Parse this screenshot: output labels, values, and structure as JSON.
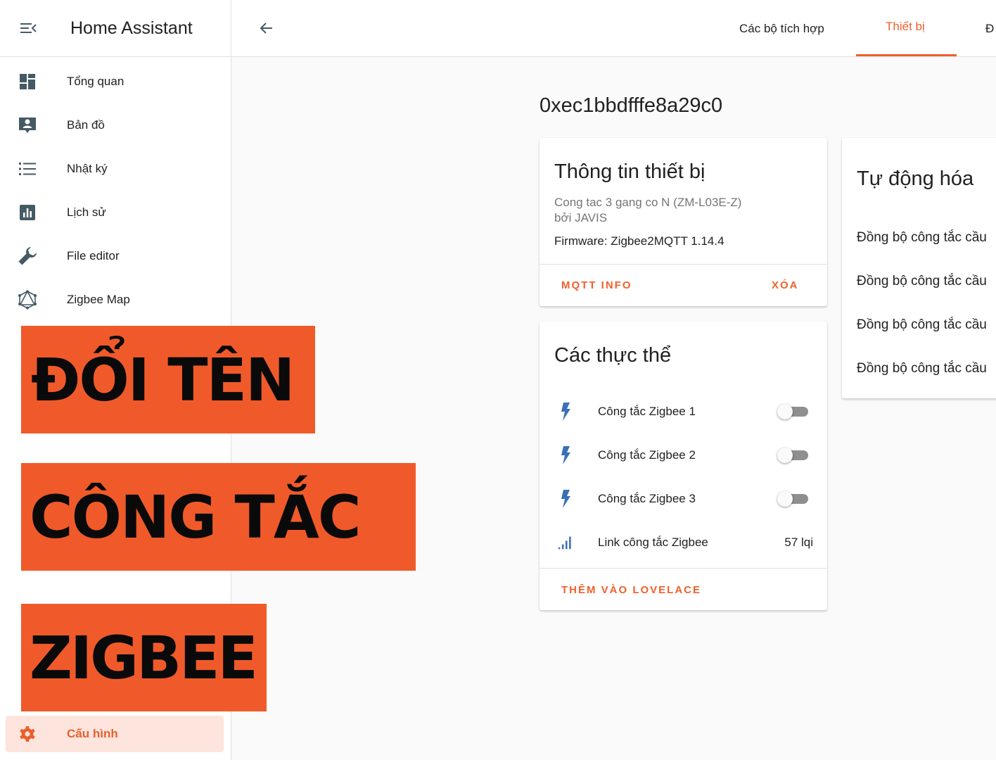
{
  "app": {
    "title": "Home Assistant"
  },
  "sidebar": {
    "items": [
      {
        "label": "Tổng quan",
        "icon": "dashboard-icon"
      },
      {
        "label": "Bản đồ",
        "icon": "map-icon"
      },
      {
        "label": "Nhật ký",
        "icon": "logbook-icon"
      },
      {
        "label": "Lịch sử",
        "icon": "history-chart-icon"
      },
      {
        "label": "File editor",
        "icon": "wrench-icon"
      },
      {
        "label": "Zigbee Map",
        "icon": "zigbee-graph-icon"
      }
    ],
    "active_item": {
      "label": "Cấu hình",
      "icon": "gear-icon"
    }
  },
  "topbar": {
    "tabs": [
      {
        "label": "Các bộ tích hợp"
      },
      {
        "label": "Thiết bị"
      },
      {
        "label": "Đ"
      }
    ],
    "active_tab": "Thiết bị"
  },
  "device": {
    "title": "0xec1bbdfffe8a29c0",
    "info_card": {
      "title": "Thông tin thiết bị",
      "model": "Cong tac 3 gang co N (ZM-L03E-Z)",
      "manufacturer": "bởi JAVIS",
      "firmware": "Firmware: Zigbee2MQTT 1.14.4",
      "actions": {
        "mqtt": "MQTT INFO",
        "delete": "XÓA"
      }
    },
    "entities_card": {
      "title": "Các thực thể",
      "entities": [
        {
          "label": "Công tắc Zigbee 1",
          "icon": "lightning-icon",
          "state": "off"
        },
        {
          "label": "Công tắc Zigbee 2",
          "icon": "lightning-icon",
          "state": "off"
        },
        {
          "label": "Công tắc Zigbee 3",
          "icon": "lightning-icon",
          "state": "off"
        },
        {
          "label": "Link công tắc Zigbee",
          "icon": "signal-icon",
          "value": "57 lqi"
        }
      ],
      "action": "THÊM VÀO LOVELACE"
    },
    "automation_card": {
      "title": "Tự động hóa",
      "items": [
        {
          "label": "Đồng bộ công tắc cầu"
        },
        {
          "label": "Đồng bộ công tắc cầu"
        },
        {
          "label": "Đồng bộ công tắc cầu"
        },
        {
          "label": "Đồng bộ công tắc cầu"
        }
      ]
    }
  },
  "overlay": {
    "lines": [
      "ĐỔI TÊN",
      "CÔNG TẮC",
      "ZIGBEE"
    ],
    "color": "#f05a2a"
  },
  "colors": {
    "accent": "#f0602c",
    "icon_blue": "#3b6fb6",
    "icon_grey": "#455a64"
  }
}
